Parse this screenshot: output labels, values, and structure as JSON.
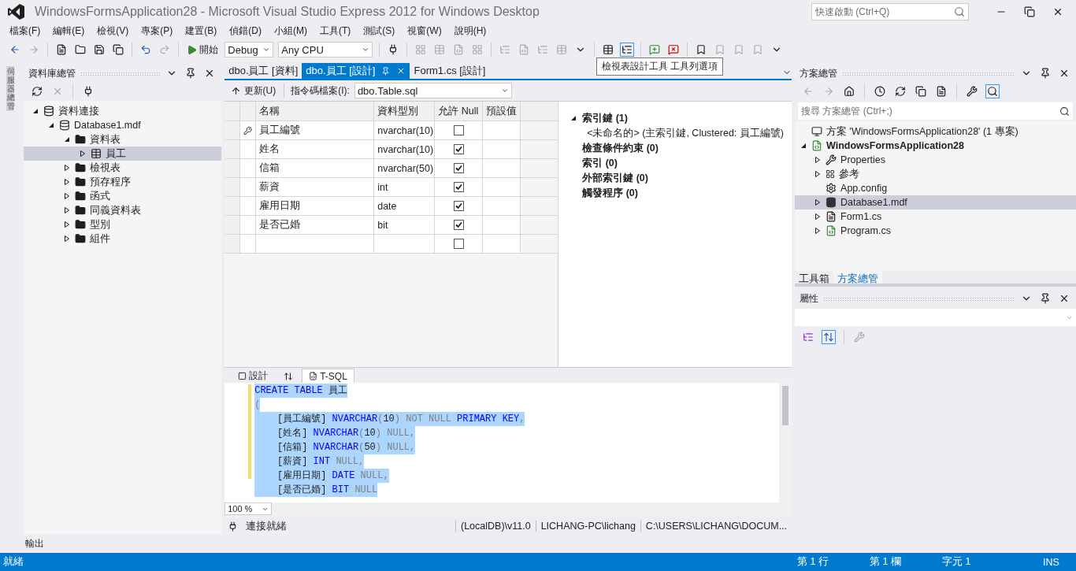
{
  "window": {
    "title": "WindowsFormsApplication28 - Microsoft Visual Studio Express 2012 for Windows Desktop"
  },
  "quick_launch": {
    "placeholder": "快速啟動 (Ctrl+Q)"
  },
  "menu": [
    "檔案(F)",
    "編輯(E)",
    "檢視(V)",
    "專案(P)",
    "建置(B)",
    "偵錯(D)",
    "小組(M)",
    "工具(T)",
    "測試(S)",
    "視窗(W)",
    "說明(H)"
  ],
  "toolbar": {
    "start": "開始",
    "configuration": "Debug",
    "platform": "Any CPU"
  },
  "tooltip": "檢視表設計工具 工具列選項",
  "side_tab": "伺服器總管",
  "database_explorer": {
    "title": "資料庫總管",
    "tree": [
      {
        "label": "資料連接",
        "kind": "connections",
        "expanded": true,
        "selected": false,
        "children": [
          {
            "label": "Database1.mdf",
            "kind": "database",
            "expanded": true,
            "selected": false,
            "children": [
              {
                "label": "資料表",
                "kind": "folder",
                "expanded": true,
                "selected": false,
                "children": [
                  {
                    "label": "員工",
                    "kind": "table",
                    "expanded": false,
                    "selected": true
                  }
                ]
              },
              {
                "label": "檢視表",
                "kind": "folder",
                "expanded": false,
                "selected": false
              },
              {
                "label": "預存程序",
                "kind": "folder",
                "expanded": false,
                "selected": false
              },
              {
                "label": "函式",
                "kind": "folder",
                "expanded": false,
                "selected": false
              },
              {
                "label": "同義資料表",
                "kind": "folder",
                "expanded": false,
                "selected": false
              },
              {
                "label": "型別",
                "kind": "folder",
                "expanded": false,
                "selected": false
              },
              {
                "label": "組件",
                "kind": "folder",
                "expanded": false,
                "selected": false
              }
            ]
          }
        ]
      }
    ]
  },
  "editor_tabs": [
    {
      "label": "dbo.員工 [資料]",
      "selected": false
    },
    {
      "label": "dbo.員工 [設計]",
      "selected": true
    },
    {
      "label": "Form1.cs [設計]",
      "selected": false
    }
  ],
  "designer": {
    "update": "更新(U)",
    "script_label": "指令碼檔案(I):",
    "script_file": "dbo.Table.sql",
    "columns": [
      "名稱",
      "資料型別",
      "允許 Null",
      "預設值"
    ],
    "rows": [
      {
        "name": "員工編號",
        "type": "nvarchar(10)",
        "allow_null": false,
        "primary_key": true
      },
      {
        "name": "姓名",
        "type": "nvarchar(10)",
        "allow_null": true,
        "primary_key": false
      },
      {
        "name": "信箱",
        "type": "nvarchar(50)",
        "allow_null": true,
        "primary_key": false
      },
      {
        "name": "薪資",
        "type": "int",
        "allow_null": true,
        "primary_key": false
      },
      {
        "name": "雇用日期",
        "type": "date",
        "allow_null": true,
        "primary_key": false
      },
      {
        "name": "是否已婚",
        "type": "bit",
        "allow_null": true,
        "primary_key": false
      }
    ],
    "new_row": {
      "allow_null": false
    },
    "keys": [
      {
        "label": "索引鍵 (1)",
        "expanded": true,
        "children": [
          {
            "label": "<未命名的> (主索引鍵, Clustered: 員工編號)"
          }
        ]
      },
      {
        "label": "檢查條件約束 (0)"
      },
      {
        "label": "索引 (0)"
      },
      {
        "label": "外部索引鍵 (0)"
      },
      {
        "label": "觸發程序 (0)"
      }
    ]
  },
  "pane_tabs": [
    {
      "label": "設計",
      "kind": "design",
      "selected": false
    },
    {
      "kind": "swap",
      "selected": false
    },
    {
      "label": "T-SQL",
      "kind": "sql",
      "selected": true
    }
  ],
  "sql": [
    [
      {
        "t": "CREATE TABLE",
        "kind": "keyword"
      },
      {
        "t": " 員工",
        "kind": "plain"
      }
    ],
    [
      {
        "t": "(",
        "kind": "gray"
      }
    ],
    [
      {
        "t": "    [員工編號] ",
        "kind": "plain"
      },
      {
        "t": "NVARCHAR",
        "kind": "keyword"
      },
      {
        "t": "(",
        "kind": "gray"
      },
      {
        "t": "10",
        "kind": "plain"
      },
      {
        "t": ") NOT NULL ",
        "kind": "gray"
      },
      {
        "t": "PRIMARY KEY",
        "kind": "keyword"
      },
      {
        "t": ",",
        "kind": "gray"
      }
    ],
    [
      {
        "t": "    [姓名] ",
        "kind": "plain"
      },
      {
        "t": "NVARCHAR",
        "kind": "keyword"
      },
      {
        "t": "(",
        "kind": "gray"
      },
      {
        "t": "10",
        "kind": "plain"
      },
      {
        "t": ") NULL,",
        "kind": "gray"
      }
    ],
    [
      {
        "t": "    [信箱] ",
        "kind": "plain"
      },
      {
        "t": "NVARCHAR",
        "kind": "keyword"
      },
      {
        "t": "(",
        "kind": "gray"
      },
      {
        "t": "50",
        "kind": "plain"
      },
      {
        "t": ") NULL,",
        "kind": "gray"
      }
    ],
    [
      {
        "t": "    [薪資] ",
        "kind": "plain"
      },
      {
        "t": "INT",
        "kind": "keyword"
      },
      {
        "t": " NULL,",
        "kind": "gray"
      }
    ],
    [
      {
        "t": "    [雇用日期] ",
        "kind": "plain"
      },
      {
        "t": "DATE",
        "kind": "keyword"
      },
      {
        "t": " NULL,",
        "kind": "gray"
      }
    ],
    [
      {
        "t": "    [是否已婚] ",
        "kind": "plain"
      },
      {
        "t": "BIT",
        "kind": "keyword"
      },
      {
        "t": " NULL",
        "kind": "gray"
      }
    ]
  ],
  "zoom": "100 %",
  "connection_status": {
    "message": "連接就緒",
    "server": "(LocalDB)\\v11.0",
    "user": "LICHANG-PC\\lichang",
    "path": "C:\\USERS\\LICHANG\\DOCUM..."
  },
  "solution_explorer": {
    "title": "方案總管",
    "search_placeholder": "搜尋 方案總管 (Ctrl+;)",
    "tree": [
      {
        "label": "方案 'WindowsFormsApplication28' (1 專案)",
        "kind": "solution",
        "selected": false,
        "bold": false,
        "children": [
          {
            "label": "WindowsFormsApplication28",
            "kind": "project",
            "expanded": true,
            "selected": false,
            "bold": true,
            "children": [
              {
                "label": "Properties",
                "kind": "properties",
                "expanded": false,
                "selected": false,
                "bold": false
              },
              {
                "label": "參考",
                "kind": "references",
                "expanded": false,
                "selected": false,
                "bold": false
              },
              {
                "label": "App.config",
                "kind": "config",
                "selected": false,
                "bold": false
              },
              {
                "label": "Database1.mdf",
                "kind": "mdf",
                "expanded": false,
                "selected": true,
                "bold": false
              },
              {
                "label": "Form1.cs",
                "kind": "form",
                "expanded": false,
                "selected": false,
                "bold": false
              },
              {
                "label": "Program.cs",
                "kind": "csharp",
                "expanded": false,
                "selected": false,
                "bold": false
              }
            ]
          }
        ]
      }
    ]
  },
  "right_tabs": [
    {
      "label": "工具箱",
      "selected": false
    },
    {
      "label": "方案總管",
      "selected": true
    }
  ],
  "properties": {
    "title": "屬性"
  },
  "output": {
    "title": "輸出"
  },
  "status_bar": {
    "message": "就緒",
    "line": "第 1 行",
    "column": "第 1 欄",
    "char": "字元 1",
    "mode": "INS"
  }
}
